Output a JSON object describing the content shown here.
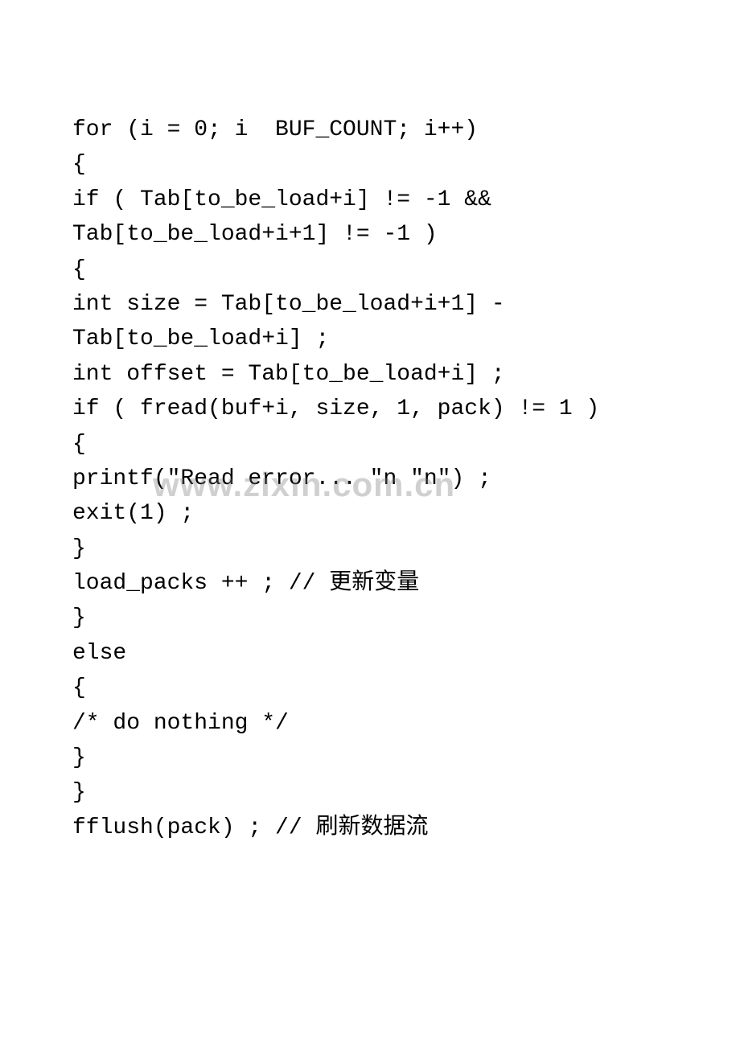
{
  "watermark": "www.zixin.com.cn",
  "code": {
    "lines": [
      "for (i = 0; i  BUF_COUNT; i++)",
      "{",
      "if ( Tab[to_be_load+i] != -1 && Tab[to_be_load+i+1] != -1 )",
      "{",
      "int size = Tab[to_be_load+i+1] - Tab[to_be_load+i] ;",
      "int offset = Tab[to_be_load+i] ;",
      "if ( fread(buf+i, size, 1, pack) != 1 )",
      "{",
      "printf(\"Read error... \"n \"n\") ;",
      "exit(1) ;",
      "}",
      "load_packs ++ ; // 更新变量",
      "}",
      "else",
      "{",
      "/* do nothing */",
      "}",
      "}",
      "fflush(pack) ; // 刷新数据流"
    ]
  }
}
